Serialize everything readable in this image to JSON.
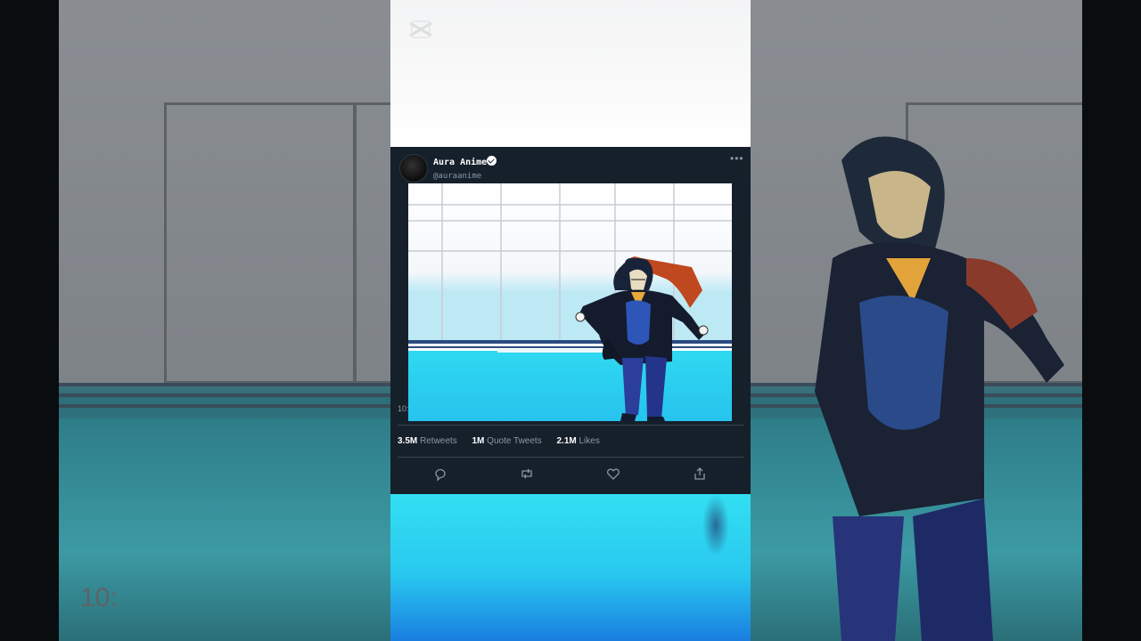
{
  "background": {
    "clock_text": "10:"
  },
  "tweet": {
    "display_name": "Aura Anime",
    "handle": "@auraanime",
    "more_icon": "more-dots-icon",
    "media_time": "10:",
    "stats": {
      "retweets_count": "3.5M",
      "retweets_label": "Retweets",
      "quotes_count": "1M",
      "quotes_label": "Quote Tweets",
      "likes_count": "2.1M",
      "likes_label": "Likes"
    },
    "actions": [
      "reply-icon",
      "retweet-icon",
      "like-icon",
      "share-icon"
    ]
  },
  "colors": {
    "tweet_bg": "#15202b",
    "muted_text": "#8b98a5",
    "divider": "#38444d",
    "floor_cyan": "#2fd9f0"
  }
}
